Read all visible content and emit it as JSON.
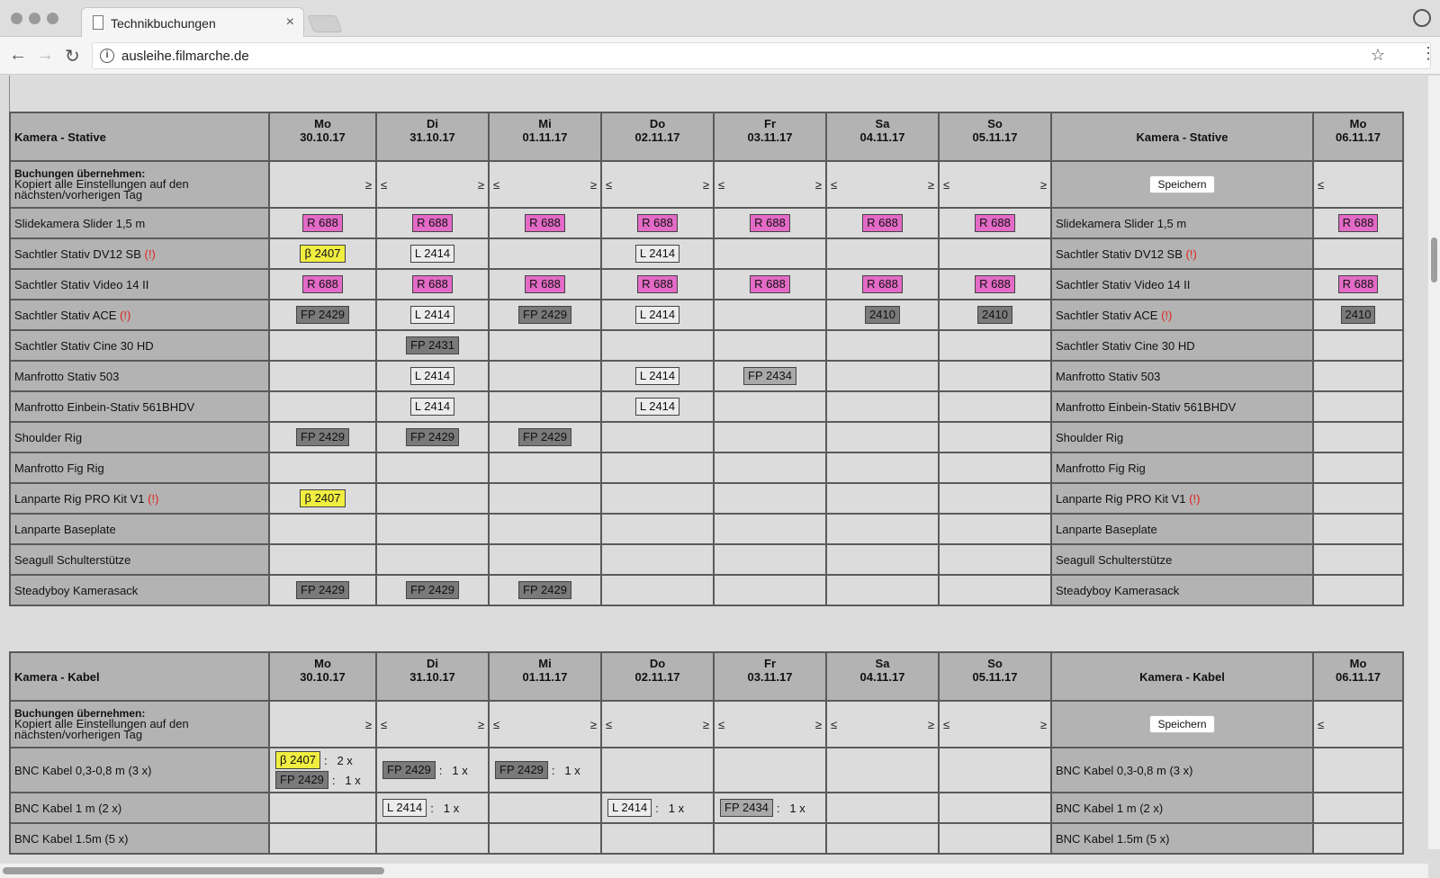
{
  "browser": {
    "tab_title": "Technikbuchungen",
    "tab_close": "×",
    "url": "ausleihe.filmarche.de",
    "back": "←",
    "forward": "→",
    "reload": "↻",
    "info": "i",
    "star": "☆",
    "menu": "⋮"
  },
  "colors": {
    "pink": "#e36ac6",
    "yellow": "#f1ee42",
    "warning": "#e0221c"
  },
  "days": [
    {
      "wd": "Mo",
      "date": "30.10.17"
    },
    {
      "wd": "Di",
      "date": "31.10.17"
    },
    {
      "wd": "Mi",
      "date": "01.11.17"
    },
    {
      "wd": "Do",
      "date": "02.11.17"
    },
    {
      "wd": "Fr",
      "date": "03.11.17"
    },
    {
      "wd": "Sa",
      "date": "04.11.17"
    },
    {
      "wd": "So",
      "date": "05.11.17"
    }
  ],
  "next_day": {
    "wd": "Mo",
    "date": "06.11.17"
  },
  "copy": {
    "title": "Buchungen übernehmen:",
    "desc": "Kopiert alle Einstellungen auf den nächsten/vorherigen Tag",
    "ge": "≥",
    "le": "≤",
    "save": "Speichern"
  },
  "warn_marker": "(!)",
  "sections": [
    {
      "title": "Kamera - Stative",
      "rows": [
        {
          "name": "Slidekamera Slider 1,5 m",
          "warn": false,
          "cells": [
            [
              "R 688",
              "pink"
            ],
            [
              "R 688",
              "pink"
            ],
            [
              "R 688",
              "pink"
            ],
            [
              "R 688",
              "pink"
            ],
            [
              "R 688",
              "pink"
            ],
            [
              "R 688",
              "pink"
            ],
            [
              "R 688",
              "pink"
            ]
          ],
          "next": [
            "R 688",
            "pink"
          ]
        },
        {
          "name": "Sachtler Stativ DV12 SB",
          "warn": true,
          "cells": [
            [
              "β 2407",
              "yellow"
            ],
            [
              "L 2414",
              "white"
            ],
            null,
            [
              "L 2414",
              "white"
            ],
            null,
            null,
            null
          ],
          "next": null
        },
        {
          "name": "Sachtler Stativ Video 14 II",
          "warn": false,
          "cells": [
            [
              "R 688",
              "pink"
            ],
            [
              "R 688",
              "pink"
            ],
            [
              "R 688",
              "pink"
            ],
            [
              "R 688",
              "pink"
            ],
            [
              "R 688",
              "pink"
            ],
            [
              "R 688",
              "pink"
            ],
            [
              "R 688",
              "pink"
            ]
          ],
          "next": [
            "R 688",
            "pink"
          ]
        },
        {
          "name": "Sachtler Stativ ACE",
          "warn": true,
          "cells": [
            [
              "FP 2429",
              "gray"
            ],
            [
              "L 2414",
              "white"
            ],
            [
              "FP 2429",
              "gray"
            ],
            [
              "L 2414",
              "white"
            ],
            null,
            [
              "2410",
              "gray"
            ],
            [
              "2410",
              "gray"
            ]
          ],
          "next": [
            "2410",
            "gray"
          ]
        },
        {
          "name": "Sachtler Stativ Cine 30 HD",
          "warn": false,
          "cells": [
            null,
            [
              "FP 2431",
              "gray"
            ],
            null,
            null,
            null,
            null,
            null
          ],
          "next": null
        },
        {
          "name": "Manfrotto Stativ 503",
          "warn": false,
          "cells": [
            null,
            [
              "L 2414",
              "white"
            ],
            null,
            [
              "L 2414",
              "white"
            ],
            [
              "FP 2434",
              "mid"
            ],
            null,
            null
          ],
          "next": null
        },
        {
          "name": "Manfrotto Einbein-Stativ 561BHDV",
          "warn": false,
          "cells": [
            null,
            [
              "L 2414",
              "white"
            ],
            null,
            [
              "L 2414",
              "white"
            ],
            null,
            null,
            null
          ],
          "next": null
        },
        {
          "name": "Shoulder Rig",
          "warn": false,
          "cells": [
            [
              "FP 2429",
              "gray"
            ],
            [
              "FP 2429",
              "gray"
            ],
            [
              "FP 2429",
              "gray"
            ],
            null,
            null,
            null,
            null
          ],
          "next": null
        },
        {
          "name": "Manfrotto Fig Rig",
          "warn": false,
          "cells": [
            null,
            null,
            null,
            null,
            null,
            null,
            null
          ],
          "next": null
        },
        {
          "name": "Lanparte Rig PRO Kit V1",
          "warn": true,
          "cells": [
            [
              "β 2407",
              "yellow"
            ],
            null,
            null,
            null,
            null,
            null,
            null
          ],
          "next": null
        },
        {
          "name": "Lanparte Baseplate",
          "warn": false,
          "cells": [
            null,
            null,
            null,
            null,
            null,
            null,
            null
          ],
          "next": null
        },
        {
          "name": "Seagull Schulterstütze",
          "warn": false,
          "cells": [
            null,
            null,
            null,
            null,
            null,
            null,
            null
          ],
          "next": null
        },
        {
          "name": "Steadyboy Kamerasack",
          "warn": false,
          "cells": [
            [
              "FP 2429",
              "gray"
            ],
            [
              "FP 2429",
              "gray"
            ],
            [
              "FP 2429",
              "gray"
            ],
            null,
            null,
            null,
            null
          ],
          "next": null
        }
      ]
    },
    {
      "title": "Kamera - Kabel",
      "rows": [
        {
          "name": "BNC Kabel 0,3-0,8 m (3 x)",
          "warn": false,
          "multi": [
            [
              [
                "β 2407",
                "yellow",
                "2 x"
              ],
              [
                "FP 2429",
                "gray",
                "1 x"
              ]
            ],
            [
              [
                "FP 2429",
                "gray",
                "1 x"
              ]
            ],
            [
              [
                "FP 2429",
                "gray",
                "1 x"
              ]
            ],
            null,
            null,
            null,
            null
          ],
          "next": null
        },
        {
          "name": "BNC Kabel 1 m (2 x)",
          "warn": false,
          "multi": [
            null,
            [
              [
                "L 2414",
                "white",
                "1 x"
              ]
            ],
            null,
            [
              [
                "L 2414",
                "white",
                "1 x"
              ]
            ],
            [
              [
                "FP 2434",
                "mid",
                "1 x"
              ]
            ],
            null,
            null
          ],
          "next": null
        },
        {
          "name": "BNC Kabel 1.5m (5 x)",
          "warn": false,
          "multi": [
            null,
            null,
            null,
            null,
            null,
            null,
            null
          ],
          "next": null
        }
      ]
    }
  ]
}
